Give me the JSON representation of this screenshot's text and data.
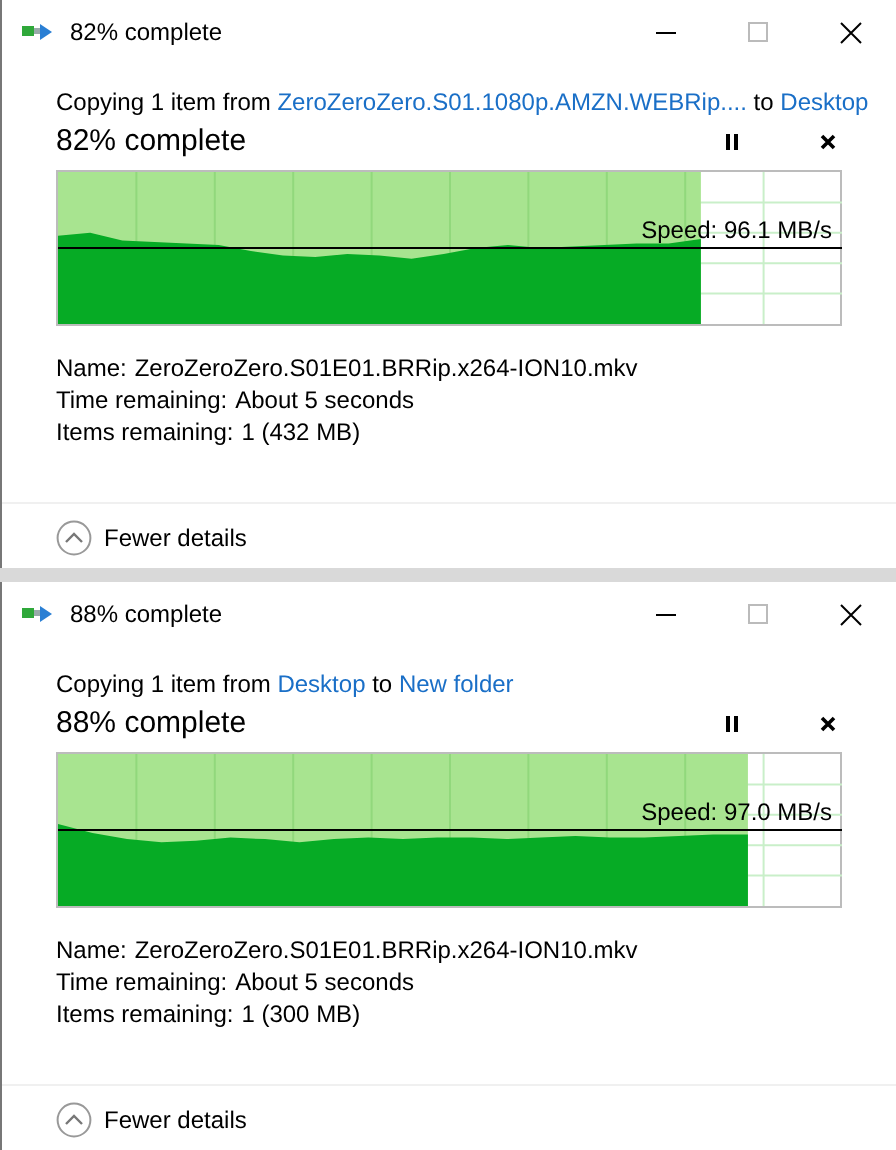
{
  "windows": [
    {
      "title": "82% complete",
      "copying": {
        "prefix": "Copying 1 item from ",
        "source": "ZeroZeroZero.S01.1080p.AMZN.WEBRip....",
        "middle": " to ",
        "destination": "Desktop"
      },
      "heading": "82% complete",
      "progress": {
        "level": 0.82,
        "speed": "Speed: 96.1 MB/s"
      },
      "details": [
        {
          "label": "Name:",
          "value": "ZeroZeroZero.S01E01.BRRip.x264-ION10.mkv"
        },
        {
          "label": "Time remaining:",
          "value": "About 5 seconds"
        },
        {
          "label": "Items remaining:",
          "value": "1 (432 MB)"
        }
      ],
      "toggle": "Fewer details"
    },
    {
      "title": "88% complete",
      "copying": {
        "prefix": "Copying 1 item from ",
        "source": "Desktop",
        "middle": " to ",
        "destination": "New folder"
      },
      "heading": "88% complete",
      "progress": {
        "level": 0.88,
        "speed": "Speed: 97.0 MB/s"
      },
      "details": [
        {
          "label": "Name:",
          "value": "ZeroZeroZero.S01E01.BRRip.x264-ION10.mkv"
        },
        {
          "label": "Time remaining:",
          "value": "About 5 seconds"
        },
        {
          "label": "Items remaining:",
          "value": "1 (300 MB)"
        }
      ],
      "toggle": "Fewer details"
    }
  ]
}
